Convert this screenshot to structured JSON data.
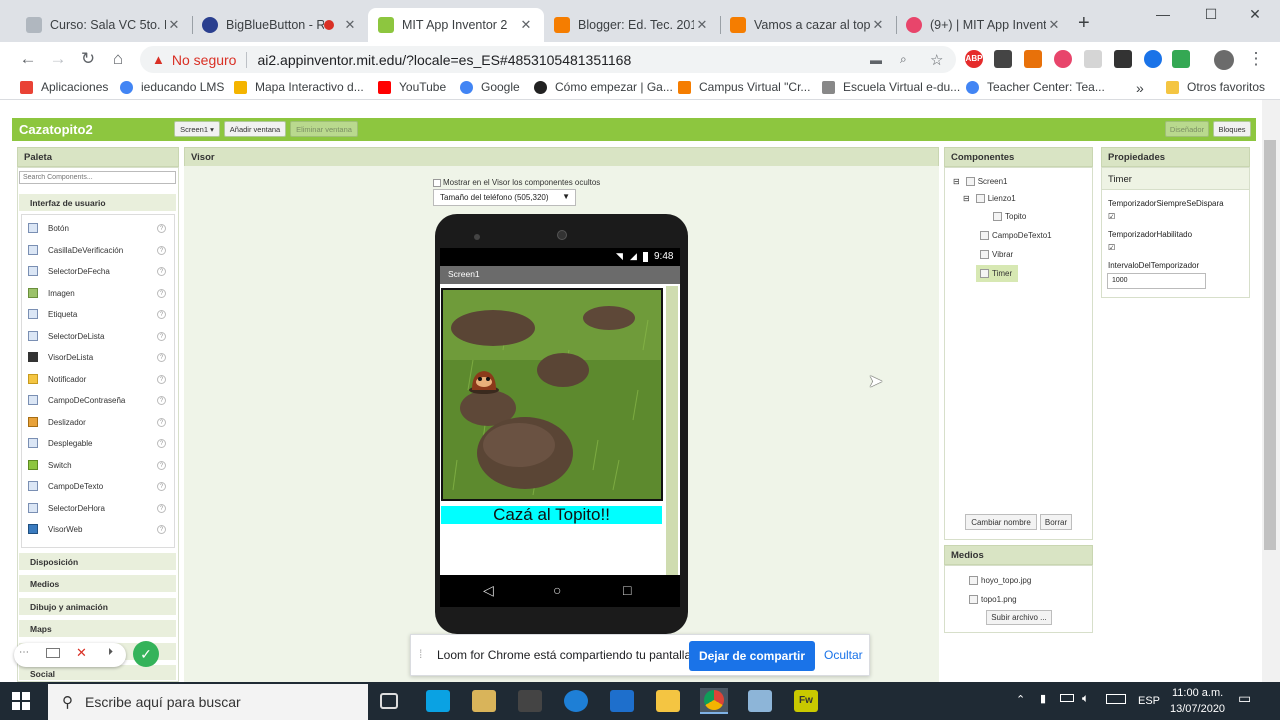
{
  "browser": {
    "tabs": [
      {
        "label": "Curso: Sala VC 5to. ECC",
        "color": "#b0b7bf"
      },
      {
        "label": "BigBlueButton - Re",
        "color": "#2a3f8f"
      },
      {
        "label": "MIT App Inventor 2",
        "color": "#8dc63f",
        "active": true
      },
      {
        "label": "Blogger: Ed. Tec. 2016/",
        "color": "#f57d00"
      },
      {
        "label": "Vamos a cazar al topo",
        "color": "#f57d00"
      },
      {
        "label": "(9+) | MIT App Invento",
        "color": "#e8456b"
      }
    ],
    "new_tab": "+",
    "insecure_label": "No seguro",
    "url": "ai2.appinventor.mit.edu/?locale=es_ES#4853105481351168",
    "bookmarks": [
      {
        "label": "Aplicaciones",
        "color": "#e94235"
      },
      {
        "label": "ieducando LMS",
        "color": "#4285f4"
      },
      {
        "label": "Mapa Interactivo d...",
        "color": "#f4b400"
      },
      {
        "label": "YouTube",
        "color": "#ff0000"
      },
      {
        "label": "Google",
        "color": "#4285f4"
      },
      {
        "label": "Cómo empezar | Ga...",
        "color": "#222"
      },
      {
        "label": "Campus Virtual \"Cr...",
        "color": "#f57d00"
      },
      {
        "label": "Escuela Virtual e-du...",
        "color": "#888"
      },
      {
        "label": "Teacher Center: Tea...",
        "color": "#4285f4"
      }
    ],
    "bookmarks_more": "»",
    "other_bookmarks": "Otros favoritos"
  },
  "app": {
    "project_name": "Cazatopito2",
    "screen_selector": "Screen1 ▾",
    "add_screen": "Añadir ventana",
    "remove_screen": "Eliminar ventana",
    "designer": "Diseñador",
    "blocks": "Bloques"
  },
  "palette": {
    "title": "Paleta",
    "search_placeholder": "Search Components...",
    "category_open": "Interfaz de usuario",
    "items": [
      "Botón",
      "CasillaDeVerificación",
      "SelectorDeFecha",
      "Imagen",
      "Etiqueta",
      "SelectorDeLista",
      "VisorDeLista",
      "Notificador",
      "CampoDeContraseña",
      "Deslizador",
      "Desplegable",
      "Switch",
      "CampoDeTexto",
      "SelectorDeHora",
      "VisorWeb"
    ],
    "help": "?",
    "categories": [
      "Disposición",
      "Medios",
      "Dibujo y animación",
      "Maps",
      "Se",
      "Social"
    ]
  },
  "viewer": {
    "title": "Visor",
    "hidden_checkbox": "Mostrar en el Visor los componentes ocultos",
    "phone_size": "Tamaño del teléfono (505,320)",
    "status_time": "9:48",
    "screen_title": "Screen1",
    "textbox_text": "Cazá al Topito!!"
  },
  "components": {
    "title": "Componentes",
    "tree": [
      "Screen1",
      "Lienzo1",
      "Topito",
      "CampoDeTexto1",
      "Vibrar",
      "Timer"
    ],
    "rename": "Cambiar nombre",
    "delete": "Borrar"
  },
  "media": {
    "title": "Medios",
    "files": [
      "hoyo_topo.jpg",
      "topo1.png"
    ],
    "upload": "Subir archivo ..."
  },
  "properties": {
    "title": "Propiedades",
    "component": "Timer",
    "prop1": "TemporizadorSiempreSeDispara",
    "prop2": "TemporizadorHabilitado",
    "prop3": "IntervaloDelTemporizador",
    "interval_value": "1000"
  },
  "loom": {
    "message": "Loom for Chrome está compartiendo tu pantalla.",
    "stop": "Dejar de compartir",
    "hide": "Ocultar"
  },
  "taskbar": {
    "search_placeholder": "Escribe aquí para buscar",
    "lang": "ESP",
    "time": "11:00 a.m.",
    "date": "13/07/2020"
  }
}
